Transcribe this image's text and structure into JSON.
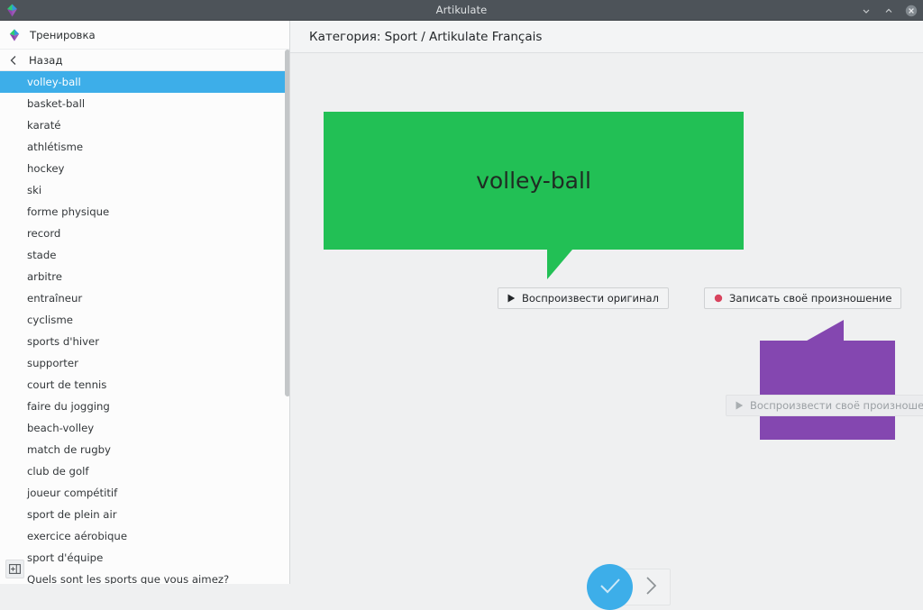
{
  "window": {
    "title": "Artikulate",
    "app_icon": "artikulate-logo-icon",
    "controls": {
      "minimize": "minimize-icon",
      "maximize": "maximize-icon",
      "close": "close-icon"
    }
  },
  "sidebar": {
    "header_label": "Тренировка",
    "header_icon": "artikulate-logo-icon",
    "back_label": "Назад",
    "back_icon": "chevron-left-icon",
    "panel_toggle_icon": "panel-toggle-icon",
    "selected_index": 0,
    "items": [
      {
        "label": "volley-ball"
      },
      {
        "label": "basket-ball"
      },
      {
        "label": "karaté"
      },
      {
        "label": "athlétisme"
      },
      {
        "label": "hockey"
      },
      {
        "label": "ski"
      },
      {
        "label": "forme physique"
      },
      {
        "label": "record"
      },
      {
        "label": "stade"
      },
      {
        "label": "arbitre"
      },
      {
        "label": "entraîneur"
      },
      {
        "label": "cyclisme"
      },
      {
        "label": "sports d'hiver"
      },
      {
        "label": "supporter"
      },
      {
        "label": "court de tennis"
      },
      {
        "label": "faire du jogging"
      },
      {
        "label": "beach-volley"
      },
      {
        "label": "match de rugby"
      },
      {
        "label": "club de golf"
      },
      {
        "label": "joueur compétitif"
      },
      {
        "label": "sport de plein air"
      },
      {
        "label": "exercice aérobique"
      },
      {
        "label": "sport d'équipe"
      },
      {
        "label": "Quels sont les sports que vous aimez?"
      }
    ]
  },
  "main": {
    "header_title": "Категория: Sport / Artikulate Français",
    "phrase": "volley-ball",
    "buttons": {
      "play_original": "Воспроизвести оригинал",
      "play_original_icon": "play-icon",
      "record": "Записать своё произношение",
      "record_icon": "record-dot-icon",
      "play_own": "Воспроизвести своё произношение",
      "play_own_icon": "play-icon-disabled"
    },
    "nav": {
      "done_icon": "check-icon",
      "next_icon": "chevron-right-icon"
    }
  },
  "colors": {
    "accent": "#3daee9",
    "bubble_original": "#22c055",
    "bubble_recording": "#8447b0",
    "titlebar": "#4d5359",
    "background": "#eff0f1"
  }
}
